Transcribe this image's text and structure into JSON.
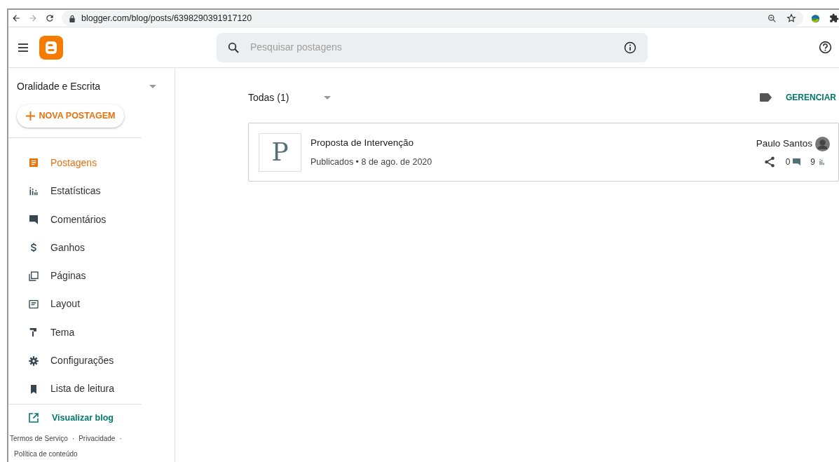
{
  "browser": {
    "url": "blogger.com/blog/posts/6398290391917120"
  },
  "header": {
    "search": {
      "placeholder": "Pesquisar postagens"
    }
  },
  "sidebar": {
    "blog_name": "Oralidade e Escrita",
    "new_post": "NOVA POSTAGEM",
    "items": [
      {
        "kind": "posts",
        "label": "Postagens",
        "selected": true
      },
      {
        "kind": "stats",
        "label": "Estatísticas",
        "selected": false
      },
      {
        "kind": "comments",
        "label": "Comentários",
        "selected": false
      },
      {
        "kind": "earnings",
        "label": "Ganhos",
        "selected": false
      },
      {
        "kind": "pages",
        "label": "Páginas",
        "selected": false
      },
      {
        "kind": "layout",
        "label": "Layout",
        "selected": false
      },
      {
        "kind": "theme",
        "label": "Tema",
        "selected": false
      },
      {
        "kind": "settings",
        "label": "Configurações",
        "selected": false
      },
      {
        "kind": "reading",
        "label": "Lista de leitura",
        "selected": false
      }
    ],
    "view_blog": "Visualizar blog",
    "footer_links": [
      {
        "kind": "link",
        "text": "Termos de Serviço"
      },
      {
        "kind": "separator",
        "text": "·"
      },
      {
        "kind": "link",
        "text": "Privacidade"
      },
      {
        "kind": "separator",
        "text": "·"
      },
      {
        "kind": "link",
        "text": "Política de conteúdo"
      }
    ]
  },
  "content": {
    "filter": "Todas (1)",
    "manage": "GERENCIAR",
    "posts": [
      {
        "thumb_letter": "P",
        "title": "Proposta de Intervenção",
        "status": "Publicados • 8 de ago. de 2020",
        "author": "Paulo Santos",
        "comments": "0",
        "views": "9"
      }
    ]
  }
}
